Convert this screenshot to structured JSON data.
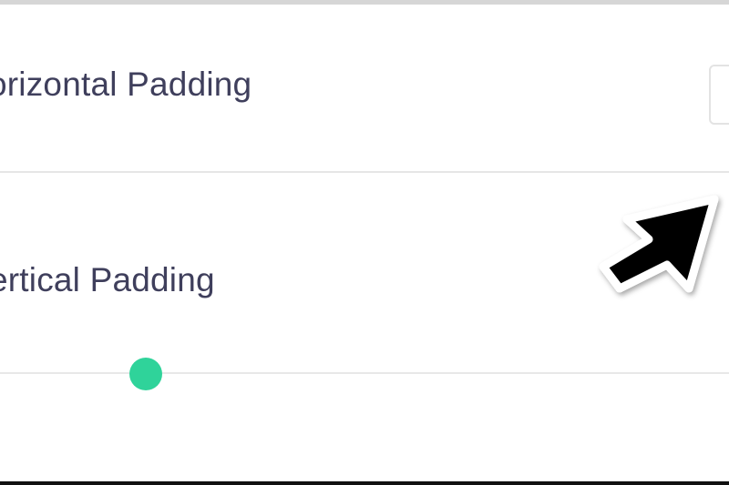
{
  "settings": {
    "horizontal_padding": {
      "label": "orizontal Padding"
    },
    "vertical_padding": {
      "label": "ertical Padding"
    }
  },
  "colors": {
    "accent": "#2fd39a",
    "label_text": "#3f3f5c"
  },
  "icons": {
    "cursor": "mouse-pointer-icon"
  }
}
